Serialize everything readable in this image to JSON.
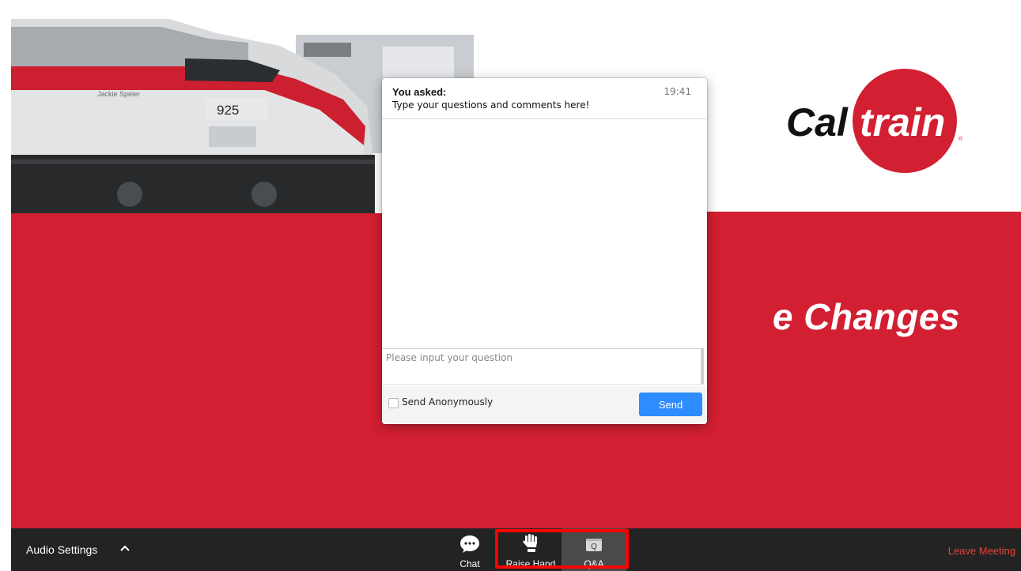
{
  "slide": {
    "title": "e Changes",
    "logo_text": "Caltrain",
    "train": {
      "name_plate": "Jackie Speier",
      "number": "925"
    },
    "colors": {
      "brand_red": "#d21f32",
      "white": "#ffffff"
    }
  },
  "qa_panel": {
    "asked_label": "You asked:",
    "question": "Type your questions and comments here!",
    "time": "19:41",
    "input_placeholder": "Please input your question",
    "anonymous_label": "Send Anonymously",
    "anonymous_checked": false,
    "send_label": "Send",
    "colors": {
      "send_button": "#2d8cff"
    }
  },
  "toolbar": {
    "audio_settings": "Audio Settings",
    "chat": "Chat",
    "raise_hand": "Raise Hand",
    "qa": "Q&A",
    "leave_meeting": "Leave Meeting",
    "active_tab": "Q&A",
    "icons": [
      "caret-up-icon",
      "chat-bubble-icon",
      "raise-hand-icon",
      "qa-icon"
    ],
    "colors": {
      "background": "#232323",
      "leave": "#e0453a",
      "highlight": "#ff0000"
    }
  }
}
